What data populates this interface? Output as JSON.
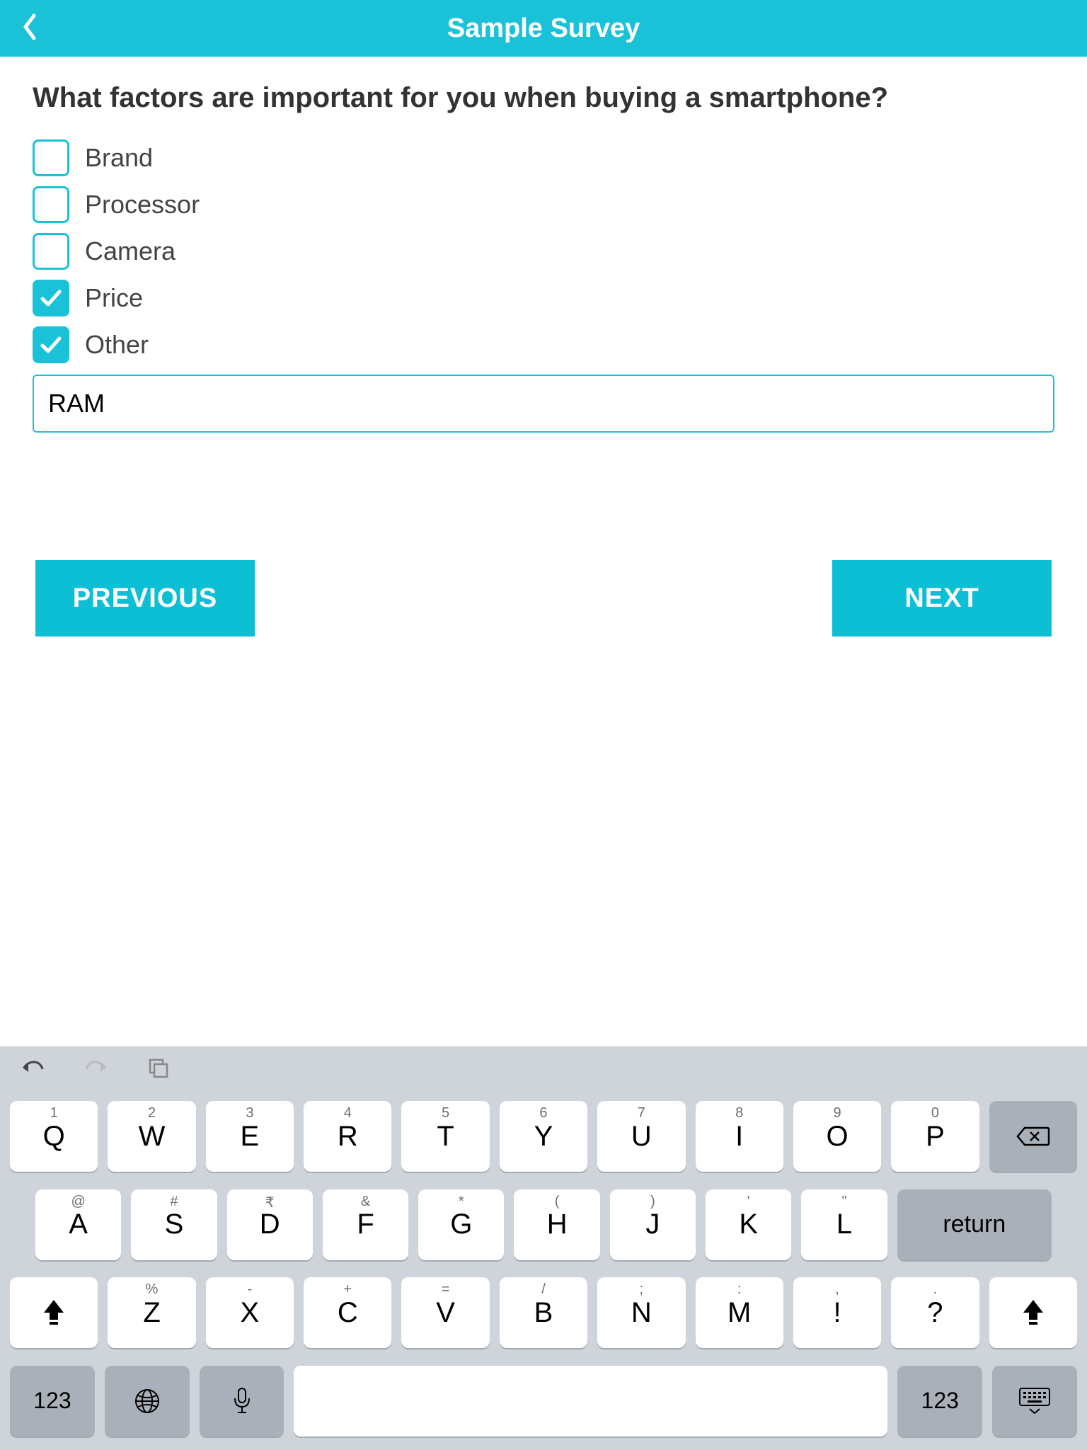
{
  "header": {
    "title": "Sample Survey"
  },
  "question": "What factors are important for you when buying a smartphone?",
  "options": [
    {
      "label": "Brand",
      "checked": false
    },
    {
      "label": "Processor",
      "checked": false
    },
    {
      "label": "Camera",
      "checked": false
    },
    {
      "label": "Price",
      "checked": true
    },
    {
      "label": "Other",
      "checked": true
    }
  ],
  "other_text": "RAM",
  "nav": {
    "previous": "PREVIOUS",
    "next": "NEXT"
  },
  "keyboard": {
    "row1": [
      {
        "main": "Q",
        "sub": "1"
      },
      {
        "main": "W",
        "sub": "2"
      },
      {
        "main": "E",
        "sub": "3"
      },
      {
        "main": "R",
        "sub": "4"
      },
      {
        "main": "T",
        "sub": "5"
      },
      {
        "main": "Y",
        "sub": "6"
      },
      {
        "main": "U",
        "sub": "7"
      },
      {
        "main": "I",
        "sub": "8"
      },
      {
        "main": "O",
        "sub": "9"
      },
      {
        "main": "P",
        "sub": "0"
      }
    ],
    "row2": [
      {
        "main": "A",
        "sub": "@"
      },
      {
        "main": "S",
        "sub": "#"
      },
      {
        "main": "D",
        "sub": "₹"
      },
      {
        "main": "F",
        "sub": "&"
      },
      {
        "main": "G",
        "sub": "*"
      },
      {
        "main": "H",
        "sub": "("
      },
      {
        "main": "J",
        "sub": ")"
      },
      {
        "main": "K",
        "sub": "'"
      },
      {
        "main": "L",
        "sub": "\""
      }
    ],
    "row3": [
      {
        "main": "Z",
        "sub": "%"
      },
      {
        "main": "X",
        "sub": "-"
      },
      {
        "main": "C",
        "sub": "+"
      },
      {
        "main": "V",
        "sub": "="
      },
      {
        "main": "B",
        "sub": "/"
      },
      {
        "main": "N",
        "sub": ";"
      },
      {
        "main": "M",
        "sub": ":"
      },
      {
        "main": "!",
        "sub": ","
      },
      {
        "main": "?",
        "sub": "."
      }
    ],
    "return": "return",
    "numKey": "123"
  }
}
